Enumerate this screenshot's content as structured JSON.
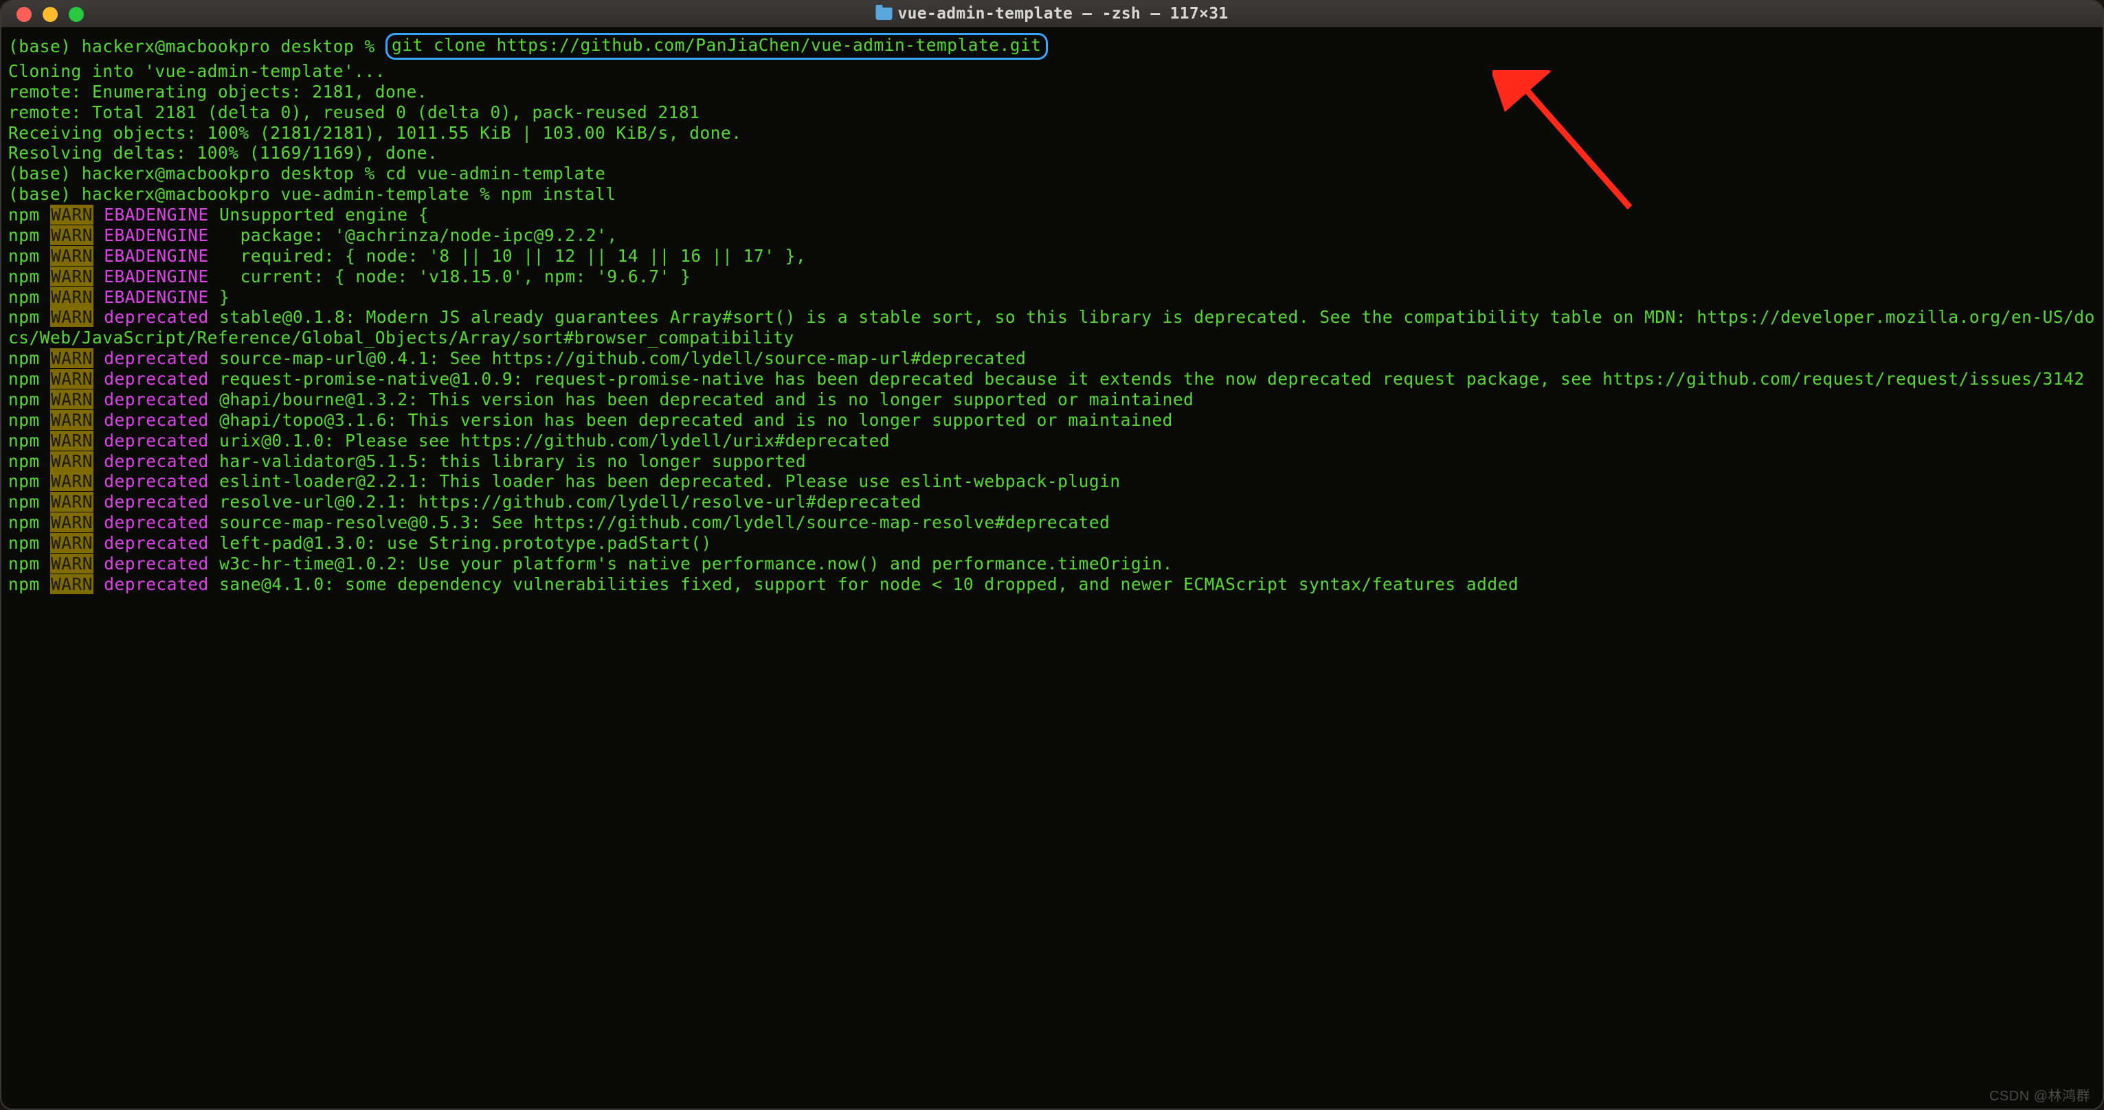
{
  "window": {
    "title": "vue-admin-template — -zsh — 117×31"
  },
  "prompt": {
    "env": "(base) ",
    "userhost1": "hackerx@macbookpro desktop % ",
    "userhost2": "hackerx@macbookpro desktop % ",
    "userhost3": "hackerx@macbookpro vue-admin-template % "
  },
  "cmd": {
    "clone": "git clone https://github.com/PanJiaChen/vue-admin-template.git",
    "cd": "cd vue-admin-template",
    "install": "npm install"
  },
  "git": {
    "line1": "Cloning into 'vue-admin-template'...",
    "line2": "remote: Enumerating objects: 2181, done.",
    "line3": "remote: Total 2181 (delta 0), reused 0 (delta 0), pack-reused 2181",
    "line4": "Receiving objects: 100% (2181/2181), 1011.55 KiB | 103.00 KiB/s, done.",
    "line5": "Resolving deltas: 100% (1169/1169), done."
  },
  "engine": {
    "l1": "Unsupported engine {",
    "l2": "  package: '@achrinza/node-ipc@9.2.2',",
    "l3": "  required: { node: '8 || 10 || 12 || 14 || 16 || 17' },",
    "l4": "  current: { node: 'v18.15.0', npm: '9.6.7' }",
    "l5": "}"
  },
  "dep": {
    "stable": "stable@0.1.8: Modern JS already guarantees Array#sort() is a stable sort, so this library is deprecated. See the compatibility table on MDN: https://developer.mozilla.org/en-US/docs/Web/JavaScript/Reference/Global_Objects/Array/sort#browser_compatibility",
    "smu": "source-map-url@0.4.1: See https://github.com/lydell/source-map-url#deprecated",
    "rpn": "request-promise-native@1.0.9: request-promise-native has been deprecated because it extends the now deprecated request package, see https://github.com/request/request/issues/3142",
    "bourne": "@hapi/bourne@1.3.2: This version has been deprecated and is no longer supported or maintained",
    "topo": "@hapi/topo@3.1.6: This version has been deprecated and is no longer supported or maintained",
    "urix": "urix@0.1.0: Please see https://github.com/lydell/urix#deprecated",
    "har": "har-validator@5.1.5: this library is no longer supported",
    "eslint": "eslint-loader@2.2.1: This loader has been deprecated. Please use eslint-webpack-plugin",
    "resurl": "resolve-url@0.2.1: https://github.com/lydell/resolve-url#deprecated",
    "smr": "source-map-resolve@0.5.3: See https://github.com/lydell/source-map-resolve#deprecated",
    "leftpad": "left-pad@1.3.0: use String.prototype.padStart()",
    "w3c": "w3c-hr-time@1.0.2: Use your platform's native performance.now() and performance.timeOrigin.",
    "sane": "sane@4.1.0: some dependency vulnerabilities fixed, support for node < 10 dropped, and newer ECMAScript syntax/features added"
  },
  "labels": {
    "npm": "npm ",
    "warn": "WARN",
    "ebad": "EBADENGINE",
    "deprecated": "deprecated"
  },
  "watermark": "CSDN @林鸿群"
}
